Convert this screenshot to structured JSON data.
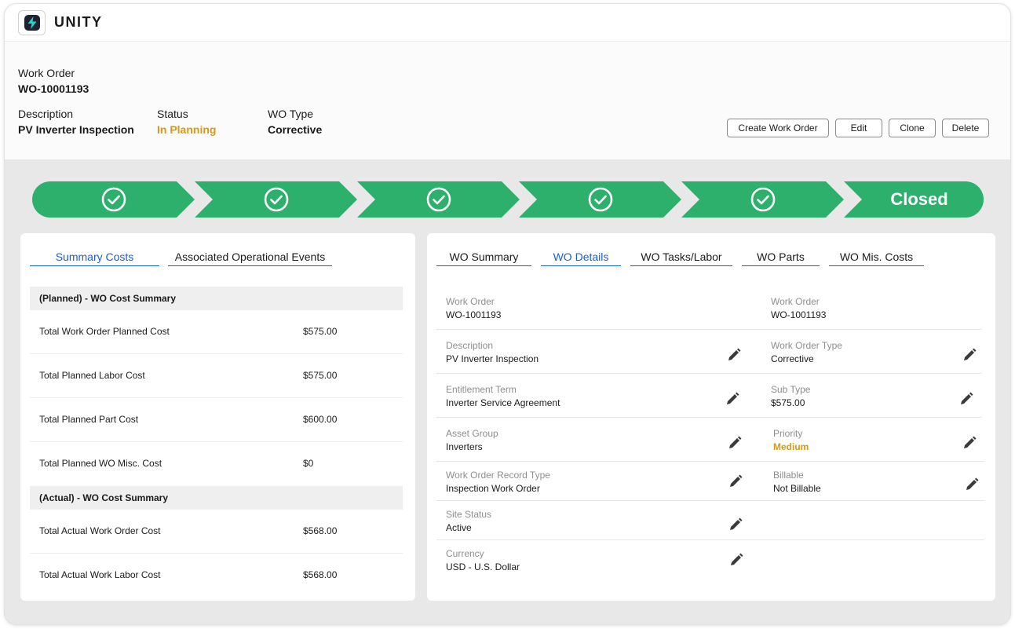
{
  "app": {
    "brand": "UNITY"
  },
  "header": {
    "work_order_label": "Work Order",
    "work_order_value": "WO-10001193",
    "description_label": "Description",
    "description_value": "PV Inverter Inspection",
    "status_label": "Status",
    "status_value": "In Planning",
    "wo_type_label": "WO Type",
    "wo_type_value": "Corrective",
    "status_color": "#d59a12"
  },
  "actions": {
    "create": "Create Work Order",
    "edit": "Edit",
    "clone": "Clone",
    "delete": "Delete"
  },
  "stepper": {
    "color": "#2db06b",
    "completed_icon": "check-circle-icon",
    "final_label": "Closed"
  },
  "left_panel": {
    "tabs": [
      "Summary Costs",
      "Associated Operational Events"
    ],
    "planned_title": "(Planned) - WO Cost Summary",
    "planned_rows": [
      {
        "label": "Total Work Order Planned Cost",
        "value": "$575.00"
      },
      {
        "label": "Total Planned Labor Cost",
        "value": "$575.00"
      },
      {
        "label": "Total Planned Part Cost",
        "value": "$600.00"
      },
      {
        "label": "Total Planned WO Misc. Cost",
        "value": "$0"
      }
    ],
    "actual_title": "(Actual) - WO Cost Summary",
    "actual_rows": [
      {
        "label": "Total Actual Work Order Cost",
        "value": "$568.00"
      },
      {
        "label": "Total Actual Work Labor Cost",
        "value": "$568.00"
      }
    ]
  },
  "right_panel": {
    "tabs": [
      "WO Summary",
      "WO Details",
      "WO Tasks/Labor",
      "WO Parts",
      "WO Mis. Costs"
    ],
    "left_fields": [
      {
        "label": "Work Order",
        "value": "WO-1001193"
      },
      {
        "label": "Description",
        "value": "PV Inverter Inspection"
      },
      {
        "label": "Entitlement Term",
        "value": "Inverter Service Agreement"
      },
      {
        "label": "Asset Group",
        "value": "Inverters"
      },
      {
        "label": "Work Order Record Type",
        "value": "Inspection Work Order"
      },
      {
        "label": "Site Status",
        "value": "Active"
      },
      {
        "label": "Currency",
        "value": "USD - U.S. Dollar"
      }
    ],
    "right_fields": [
      {
        "label": "Work Order",
        "value": "WO-1001193"
      },
      {
        "label": "Work Order Type",
        "value": "Corrective"
      },
      {
        "label": "Sub Type",
        "value": "$575.00"
      },
      {
        "label": "Priority",
        "value": "Medium"
      },
      {
        "label": "Billable",
        "value": "Not Billable"
      }
    ],
    "active_tab_color": "#1a5fcf",
    "priority_color": "#d59a12"
  }
}
